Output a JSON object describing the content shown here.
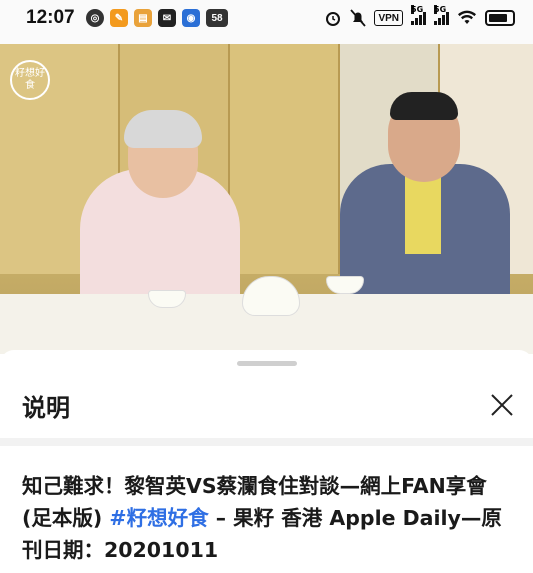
{
  "status_bar": {
    "time": "12:07",
    "notification_badge": "58",
    "vpn_label": "VPN",
    "signal_label_1": "5G",
    "signal_label_2": "5G"
  },
  "video": {
    "channel_logo_text": "籽想好食"
  },
  "sheet": {
    "title": "说明",
    "description_part1": "知己難求！黎智英VS蔡瀾食住對談—網上FAN享會 (足本版) ",
    "hashtag": "#籽想好食",
    "description_part2": " – 果籽 香港 Apple Daily—原刊日期：20201011"
  },
  "colors": {
    "hashtag": "#2f6fe4",
    "text": "#1a1a1a"
  }
}
